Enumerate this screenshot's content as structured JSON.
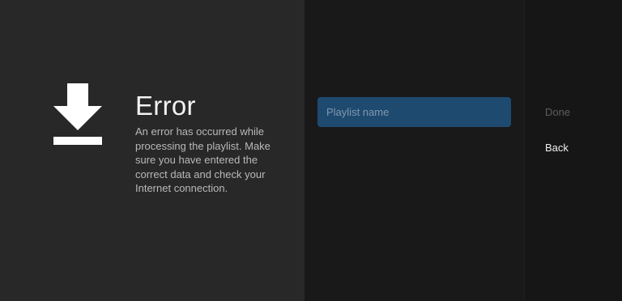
{
  "error_panel": {
    "icon": "download-icon",
    "title": "Error",
    "message": "An error has occurred while processing the playlist. Make sure you have entered the correct data and check your Internet connection."
  },
  "form": {
    "playlist_name": {
      "value": "",
      "placeholder": "Playlist name"
    }
  },
  "actions": {
    "done_label": "Done",
    "done_enabled": false,
    "back_label": "Back"
  },
  "colors": {
    "left_panel_bg": "#282828",
    "middle_panel_bg": "#191919",
    "right_panel_bg": "#161616",
    "input_focus_bg": "#1f4a70",
    "disabled_text": "#5e5e5e",
    "primary_text": "#f0f0f0"
  }
}
